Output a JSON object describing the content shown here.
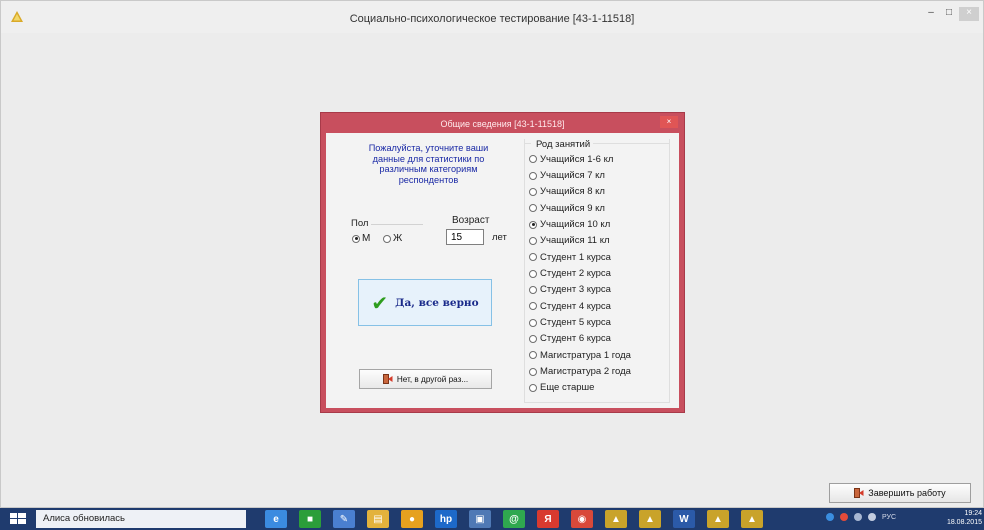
{
  "window": {
    "title": "Социально-психологическое тестирование [43-1-11518]",
    "minimize_icon": "minimize-icon",
    "maximize_icon": "maximize-icon",
    "close_icon": "close-icon"
  },
  "dialog": {
    "title": "Общие сведения [43-1-11518]",
    "close_label": "×",
    "prompt": "Пожалуйста, уточните ваши данные для статистики по различным категориям респондентов",
    "sex_legend": "Пол",
    "sex_options": [
      {
        "label": "М",
        "selected": true
      },
      {
        "label": "Ж",
        "selected": false
      }
    ],
    "age_label": "Возраст",
    "age_value": "15",
    "age_unit": "лет",
    "confirm_label": "Да, все верно",
    "decline_label": "Нет, в другой раз...",
    "occupation_legend": "Род занятий",
    "occupations": [
      {
        "label": "Учащийся 1-6 кл",
        "selected": false
      },
      {
        "label": "Учащийся 7 кл",
        "selected": false
      },
      {
        "label": "Учащийся 8 кл",
        "selected": false
      },
      {
        "label": "Учащийся 9 кл",
        "selected": false
      },
      {
        "label": "Учащийся 10 кл",
        "selected": true
      },
      {
        "label": "Учащийся 11 кл",
        "selected": false
      },
      {
        "label": "Студент 1 курса",
        "selected": false
      },
      {
        "label": "Студент 2 курса",
        "selected": false
      },
      {
        "label": "Студент 3 курса",
        "selected": false
      },
      {
        "label": "Студент 4 курса",
        "selected": false
      },
      {
        "label": "Студент 5 курса",
        "selected": false
      },
      {
        "label": "Студент 6 курса",
        "selected": false
      },
      {
        "label": "Магистратура 1 года",
        "selected": false
      },
      {
        "label": "Магистратура 2 года",
        "selected": false
      },
      {
        "label": "Еще старше",
        "selected": false
      }
    ]
  },
  "finish_button": {
    "label": "Завершить работу"
  },
  "taskbar": {
    "notification": "Алиса обновилась",
    "icons": [
      {
        "name": "internet-explorer-icon",
        "glyph": "e",
        "color": "#3b8be0"
      },
      {
        "name": "store-icon",
        "glyph": "■",
        "color": "#2b9e3a"
      },
      {
        "name": "feather-icon",
        "glyph": "✎",
        "color": "#4a7fd0"
      },
      {
        "name": "file-explorer-icon",
        "glyph": "▤",
        "color": "#e3b23c"
      },
      {
        "name": "media-player-icon",
        "glyph": "●",
        "color": "#e6a11f"
      },
      {
        "name": "hp-icon",
        "glyph": "hp",
        "color": "#1d69c9"
      },
      {
        "name": "screen-icon",
        "glyph": "▣",
        "color": "#4f79b5"
      },
      {
        "name": "mail-at-icon",
        "glyph": "@",
        "color": "#2fa84f"
      },
      {
        "name": "yandex-browser-icon",
        "glyph": "Я",
        "color": "#d83a2f"
      },
      {
        "name": "chrome-icon",
        "glyph": "◉",
        "color": "#d9493a"
      },
      {
        "name": "test-app-icon",
        "glyph": "▲",
        "color": "#c9a32a"
      },
      {
        "name": "test-app-icon",
        "glyph": "▲",
        "color": "#c9a32a"
      },
      {
        "name": "word-icon",
        "glyph": "W",
        "color": "#2b5aa8"
      },
      {
        "name": "test-app-icon",
        "glyph": "▲",
        "color": "#c9a32a"
      },
      {
        "name": "test-app-icon",
        "glyph": "▲",
        "color": "#c9a32a"
      }
    ],
    "language": "РУС",
    "time": "19:24",
    "date": "18.08.2015"
  },
  "colors": {
    "dialog_frame": "#c84f5e",
    "prompt_text": "#1b2aa6",
    "confirm_bg": "#e7f2fb",
    "checkmark": "#2e9d1e",
    "taskbar": "#1f3b6e"
  }
}
